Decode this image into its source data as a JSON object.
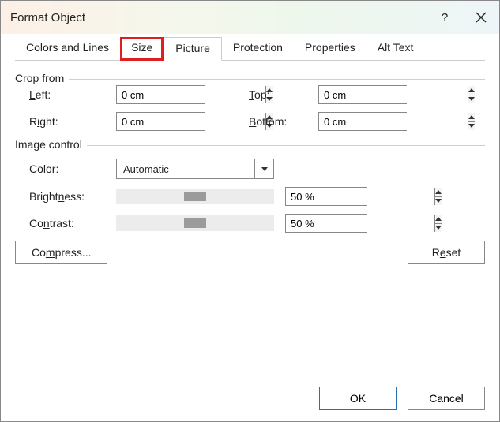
{
  "window": {
    "title": "Format Object",
    "help": "?"
  },
  "tabs": {
    "colors_lines": "Colors and Lines",
    "size": "Size",
    "picture": "Picture",
    "protection": "Protection",
    "properties": "Properties",
    "alt_text": "Alt Text"
  },
  "crop": {
    "section": "Crop from",
    "left_prefix": "L",
    "left_rest": "eft:",
    "right_r": "R",
    "right_rest": "ight:",
    "top_t": "T",
    "top_rest": "op:",
    "bottom_b": "B",
    "bottom_rest": "ottom:",
    "left_val": "0 cm",
    "right_val": "0 cm",
    "top_val": "0 cm",
    "bottom_val": "0 cm"
  },
  "image": {
    "section": "Image control",
    "color_c": "C",
    "color_rest": "olor:",
    "color_val": "Automatic",
    "brightness_label": "Brightness:",
    "brightness_val": "50 %",
    "contrast_label_pre": "Co",
    "contrast_n": "n",
    "contrast_label_post": "trast:",
    "contrast_val": "50 %"
  },
  "buttons": {
    "compress_pre": "Co",
    "compress_m": "m",
    "compress_post": "press...",
    "reset_r": "R",
    "reset_e": "e",
    "reset_post": "set",
    "ok": "OK",
    "cancel": "Cancel"
  }
}
